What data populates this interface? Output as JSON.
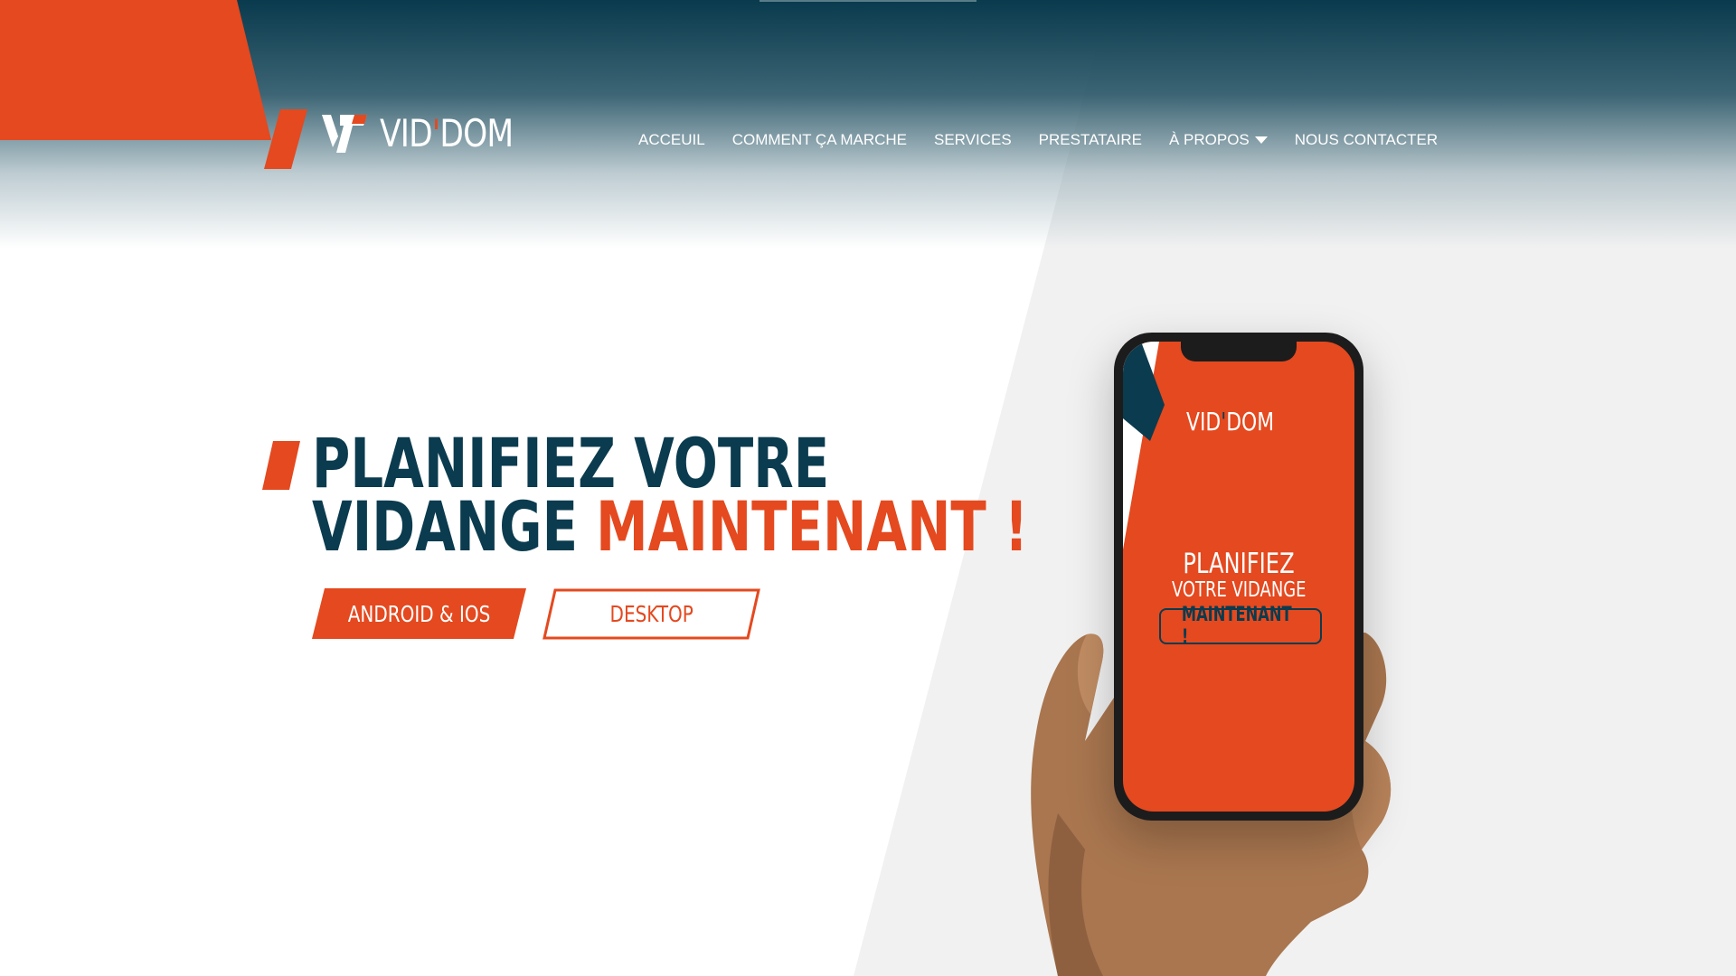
{
  "brand": {
    "name": "VID",
    "apostrophe": "'",
    "suffix": "DOM"
  },
  "nav": {
    "items": [
      {
        "label": "ACCEUIL"
      },
      {
        "label": "COMMENT ÇA MARCHE"
      },
      {
        "label": "SERVICES"
      },
      {
        "label": "PRESTATAIRE"
      },
      {
        "label": "À PROPOS",
        "icon": "caret-down-icon"
      },
      {
        "label": "NOUS CONTACTER"
      }
    ]
  },
  "hero": {
    "line1": "PLANIFIEZ VOTRE",
    "line2_dark": "VIDANGE ",
    "line2_highlight": "MAINTENANT !",
    "buttons": {
      "android": "ANDROID & IOS",
      "desktop": "DESKTOP"
    }
  },
  "phone_screen": {
    "logo_name": "VID",
    "logo_apostrophe": "'",
    "logo_suffix": "DOM",
    "title": "PLANIFIEZ",
    "subtitle": "VOTRE VIDANGE",
    "cta": "MAINTENANT !"
  },
  "colors": {
    "accent": "#e4491f",
    "dark": "#0b3b4e",
    "header_gradient_top": "#093a4d",
    "gray_panel": "#f1f1f1"
  }
}
